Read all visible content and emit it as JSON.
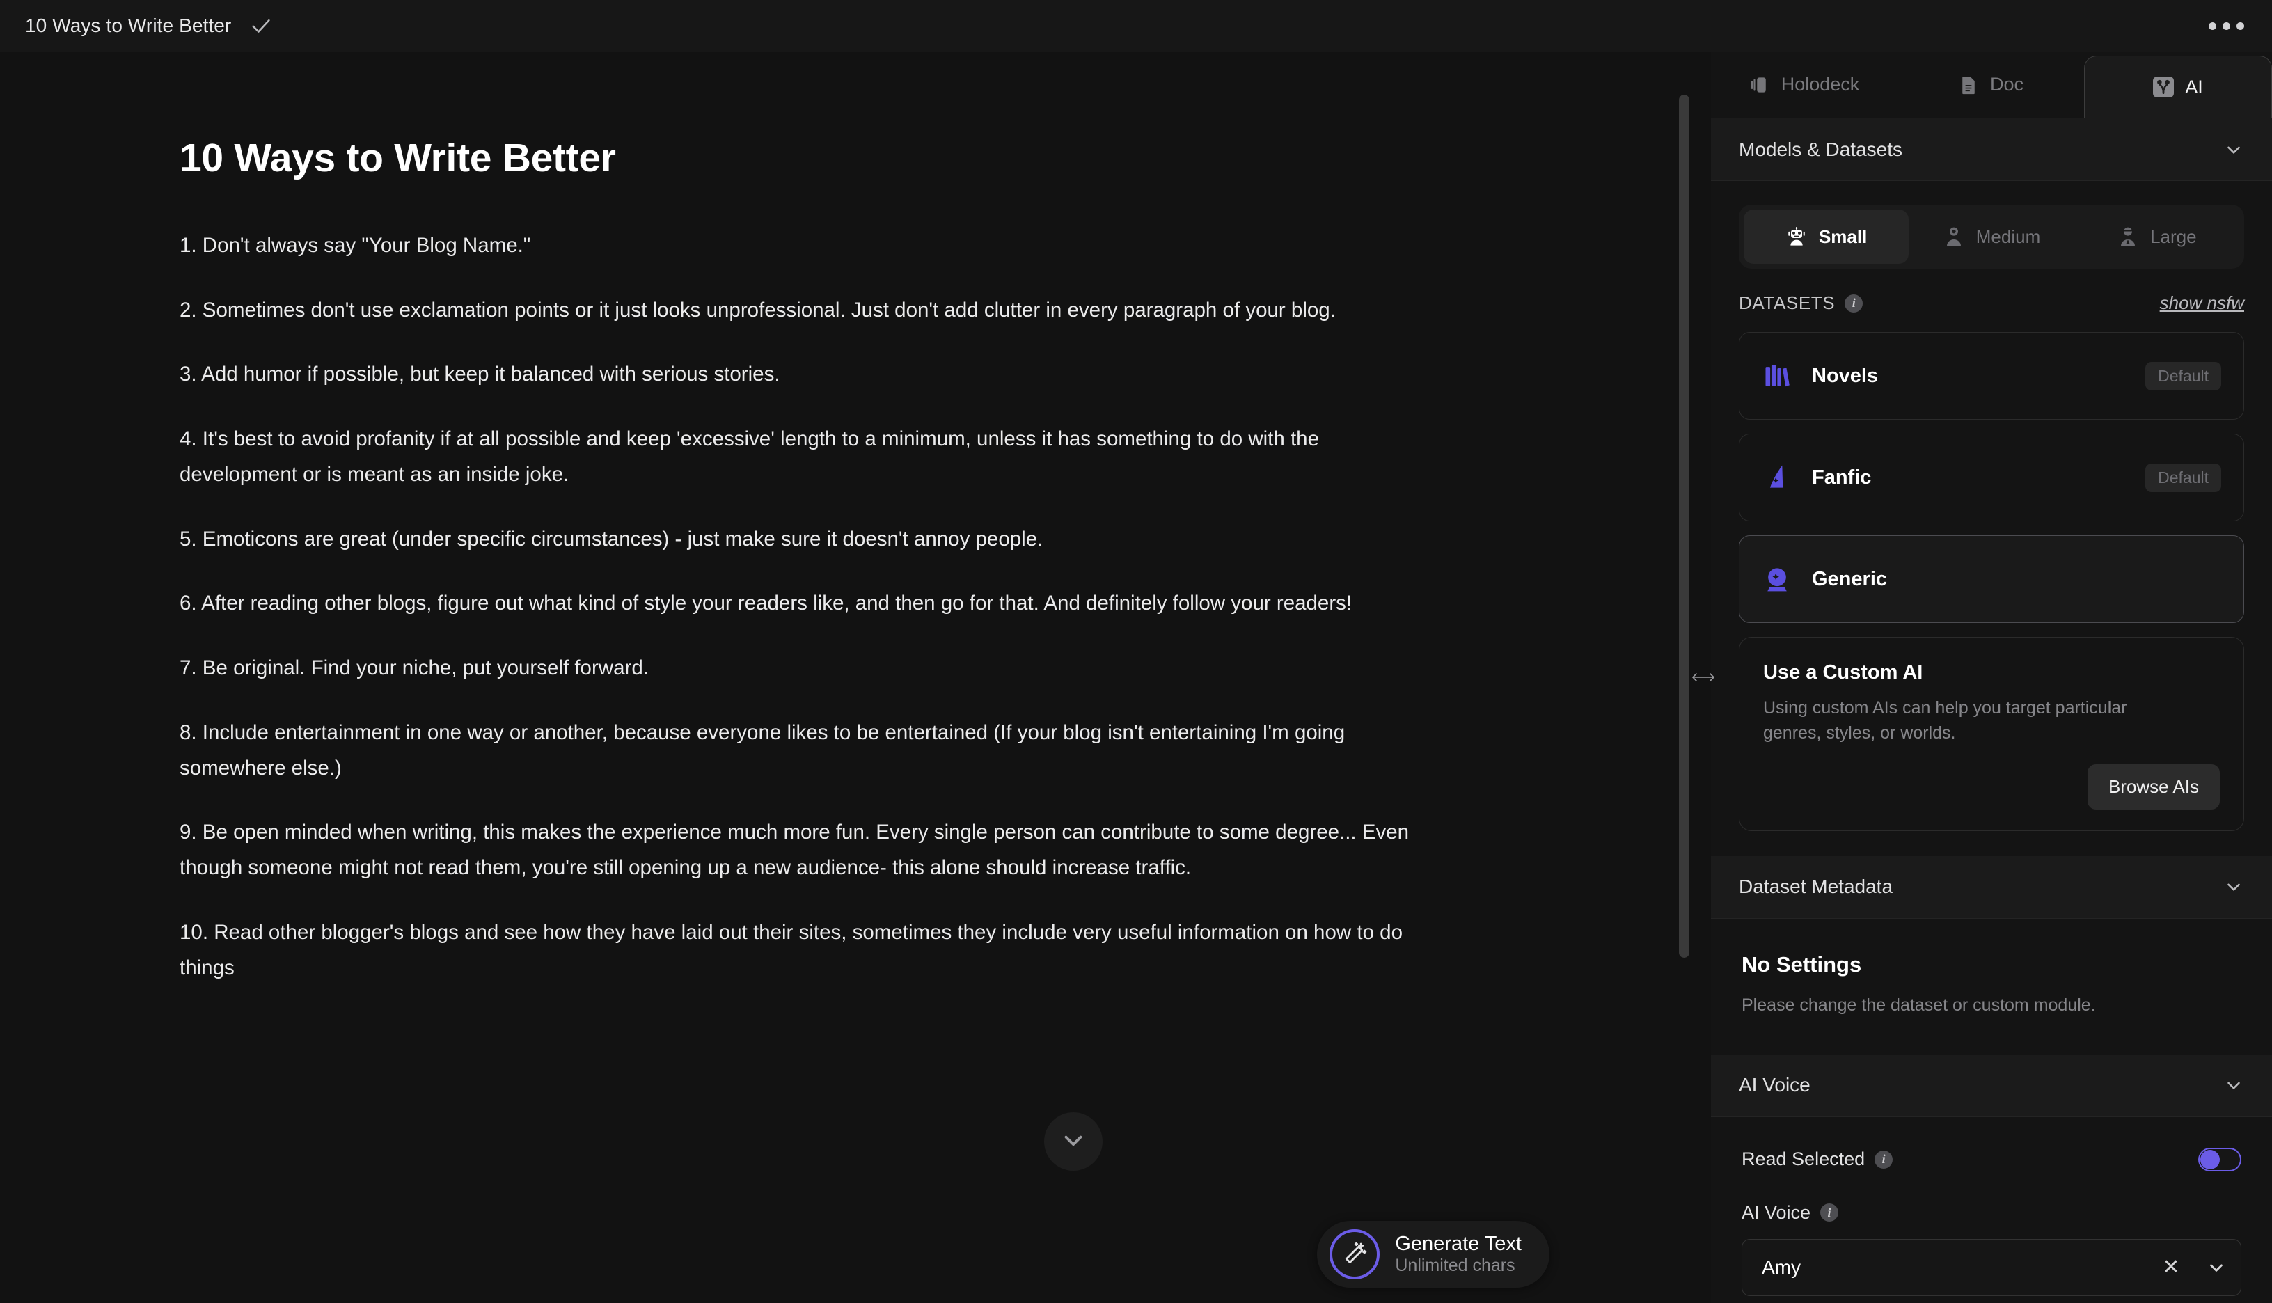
{
  "topbar": {
    "doc_title": "10 Ways to Write Better",
    "saved_icon": "check-icon",
    "menu_icon": "more-options-icon"
  },
  "editor": {
    "heading": "10 Ways to Write Better",
    "paragraphs": [
      "1. Don't always say \"Your Blog Name.\"",
      "2. Sometimes don't use exclamation points or it just looks unprofessional. Just don't add clutter in every paragraph of your blog.",
      "3. Add humor if possible, but keep it balanced with serious stories.",
      "4.  It's best to avoid profanity if at all possible and keep 'excessive' length to a minimum, unless it has something to do with the development or is meant as an inside joke.",
      "5. Emoticons are great (under specific circumstances) - just make sure it doesn't annoy people.",
      "6. After reading other blogs, figure out what kind of style your readers like, and then go for that. And definitely follow your readers!",
      "7. Be original. Find your niche, put yourself forward.",
      "8. Include entertainment in one way or another, because everyone likes to be entertained (If your blog isn't entertaining I'm going somewhere else.)",
      "9. Be open minded when writing, this makes the experience much more fun. Every single person can contribute to some degree... Even though someone might not read them, you're still opening up a new audience- this alone should increase traffic.",
      "10. Read other blogger's blogs and see how they have laid out their sites, sometimes they include very useful information on how to do things"
    ],
    "scroll_down_icon": "chevron-down-icon"
  },
  "generate": {
    "title": "Generate Text",
    "subtitle": "Unlimited chars",
    "icon": "magic-wand-icon"
  },
  "divider": {
    "resize_icon": "horizontal-resize-icon"
  },
  "panel": {
    "tabs": [
      {
        "label": "Holodeck",
        "icon": "holodeck-icon",
        "active": false
      },
      {
        "label": "Doc",
        "icon": "document-icon",
        "active": false
      },
      {
        "label": "AI",
        "icon": "ai-icon",
        "active": true
      }
    ],
    "models_datasets": {
      "title": "Models & Datasets",
      "collapse_icon": "chevron-down-icon",
      "sizes": [
        {
          "label": "Small",
          "icon": "robot-icon",
          "active": true
        },
        {
          "label": "Medium",
          "icon": "astronaut-icon",
          "active": false
        },
        {
          "label": "Large",
          "icon": "person-icon",
          "active": false
        }
      ],
      "datasets_label": "DATASETS",
      "datasets_info_icon": "info-icon",
      "nsfw_link": "show nsfw",
      "datasets": [
        {
          "name": "Novels",
          "icon": "books-icon",
          "badge": "Default",
          "selected": false
        },
        {
          "name": "Fanfic",
          "icon": "wizard-hat-icon",
          "badge": "Default",
          "selected": false
        },
        {
          "name": "Generic",
          "icon": "crystal-ball-icon",
          "badge": "",
          "selected": true
        }
      ],
      "custom_ai": {
        "title": "Use a Custom AI",
        "description": "Using custom AIs can help you target particular genres, styles, or worlds.",
        "button_label": "Browse AIs"
      }
    },
    "dataset_metadata": {
      "title": "Dataset Metadata",
      "collapse_icon": "chevron-down-icon",
      "empty_title": "No Settings",
      "empty_desc": "Please change the dataset or custom module."
    },
    "ai_voice": {
      "title": "AI Voice",
      "collapse_icon": "chevron-down-icon",
      "read_selected_label": "Read Selected",
      "read_selected_info_icon": "info-icon",
      "read_selected_on": true,
      "voice_field_label": "AI Voice",
      "voice_field_info_icon": "info-icon",
      "voice_value": "Amy",
      "clear_icon": "close-icon",
      "dropdown_icon": "chevron-down-icon"
    }
  },
  "colors": {
    "accent": "#6b5ce7",
    "bg": "#121212",
    "panel_bg": "#161616",
    "text": "#ebebec"
  }
}
